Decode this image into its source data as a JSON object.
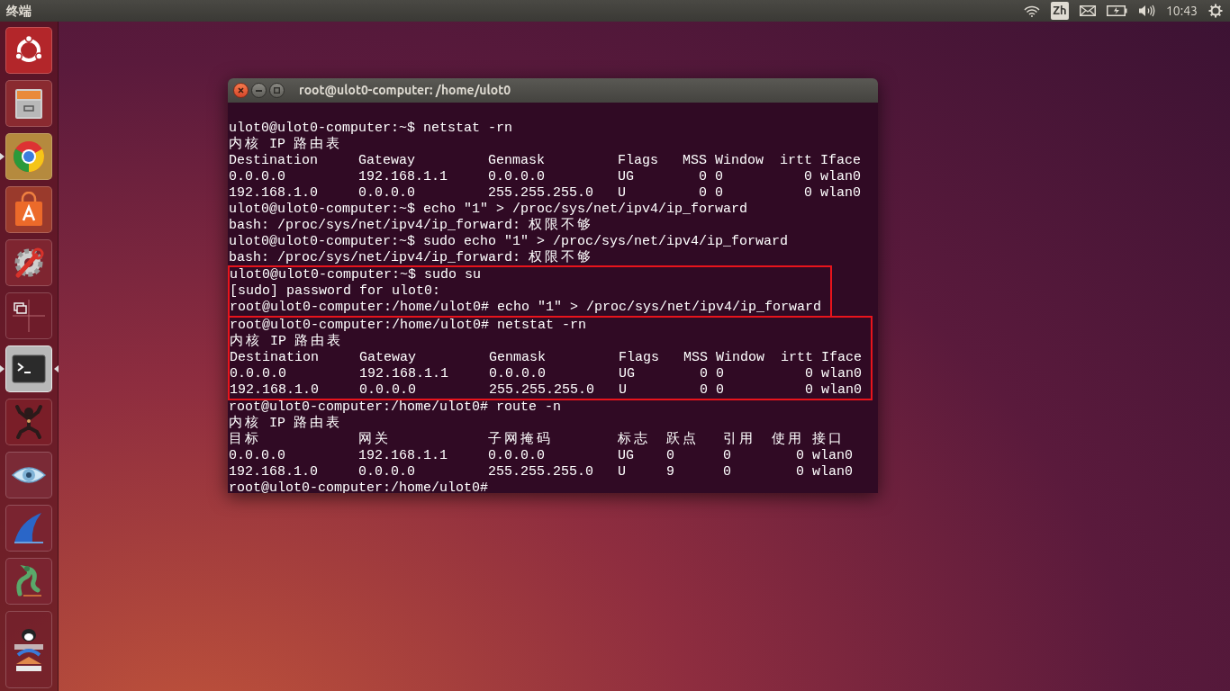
{
  "top_bar": {
    "app_title": "终端",
    "input_method": "Zh",
    "clock": "10:43"
  },
  "launcher": {
    "items": [
      {
        "kind": "dash",
        "running": false,
        "focused": false
      },
      {
        "kind": "files",
        "running": false,
        "focused": false
      },
      {
        "kind": "browser",
        "running": true,
        "focused": false
      },
      {
        "kind": "store",
        "running": false,
        "focused": false
      },
      {
        "kind": "settings",
        "running": false,
        "focused": false
      },
      {
        "kind": "workspaces",
        "running": false,
        "focused": false
      },
      {
        "kind": "terminal",
        "running": true,
        "focused": true
      },
      {
        "kind": "figure",
        "running": false,
        "focused": false
      },
      {
        "kind": "eye",
        "running": false,
        "focused": false
      },
      {
        "kind": "fin",
        "running": false,
        "focused": false
      },
      {
        "kind": "dragon",
        "running": false,
        "focused": false
      },
      {
        "kind": "stack",
        "running": false,
        "focused": false
      }
    ]
  },
  "terminal": {
    "title": "root@ulot0-computer: /home/ulot0",
    "blocks": [
      {
        "highlighted": false,
        "lines": [
          "ulot0@ulot0-computer:~$ netstat -rn",
          "内核 IP 路由表",
          "Destination     Gateway         Genmask         Flags   MSS Window  irtt Iface",
          "0.0.0.0         192.168.1.1     0.0.0.0         UG        0 0          0 wlan0",
          "192.168.1.0     0.0.0.0         255.255.255.0   U         0 0          0 wlan0",
          "ulot0@ulot0-computer:~$ echo \"1\" > /proc/sys/net/ipv4/ip_forward",
          "bash: /proc/sys/net/ipv4/ip_forward: 权限不够",
          "ulot0@ulot0-computer:~$ sudo echo \"1\" > /proc/sys/net/ipv4/ip_forward",
          "bash: /proc/sys/net/ipv4/ip_forward: 权限不够"
        ]
      },
      {
        "highlighted": true,
        "lines": [
          "ulot0@ulot0-computer:~$ sudo su",
          "[sudo] password for ulot0:",
          "root@ulot0-computer:/home/ulot0# echo \"1\" > /proc/sys/net/ipv4/ip_forward"
        ]
      },
      {
        "highlighted": true,
        "lines": [
          "root@ulot0-computer:/home/ulot0# netstat -rn",
          "内核 IP 路由表",
          "Destination     Gateway         Genmask         Flags   MSS Window  irtt Iface",
          "0.0.0.0         192.168.1.1     0.0.0.0         UG        0 0          0 wlan0",
          "192.168.1.0     0.0.0.0         255.255.255.0   U         0 0          0 wlan0"
        ]
      },
      {
        "highlighted": false,
        "lines": [
          "root@ulot0-computer:/home/ulot0# route -n",
          "内核 IP 路由表",
          {
            "kind": "columns",
            "cells": [
              "目标",
              "网关",
              "子网掩码",
              "标志",
              "跃点",
              "引用",
              "使用",
              "接口"
            ]
          },
          "0.0.0.0         192.168.1.1     0.0.0.0         UG    0      0        0 wlan0",
          "192.168.1.0     0.0.0.0         255.255.255.0   U     9      0        0 wlan0",
          "root@ulot0-computer:/home/ulot0# "
        ]
      }
    ]
  }
}
